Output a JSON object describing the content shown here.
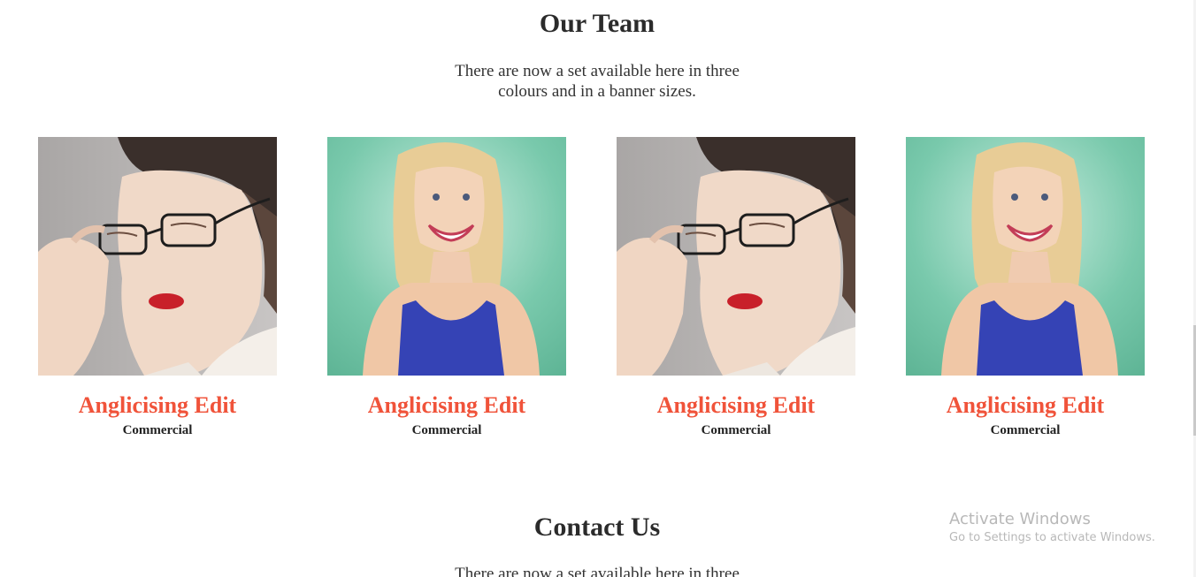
{
  "team": {
    "title": "Our Team",
    "description_lines": [
      "There are now a set available here in three",
      "colours and in a banner sizes."
    ],
    "members": [
      {
        "name": "Anglicising Edit",
        "role": "Commercial",
        "photo": "brunette-glasses-portrait"
      },
      {
        "name": "Anglicising Edit",
        "role": "Commercial",
        "photo": "blonde-smiling-portrait"
      },
      {
        "name": "Anglicising Edit",
        "role": "Commercial",
        "photo": "brunette-glasses-portrait"
      },
      {
        "name": "Anglicising Edit",
        "role": "Commercial",
        "photo": "blonde-smiling-portrait"
      }
    ]
  },
  "contact": {
    "title": "Contact Us",
    "description_line": "There are now a set available here in three"
  },
  "watermark": {
    "line1": "Activate Windows",
    "line2": "Go to Settings to activate Windows."
  },
  "colors": {
    "accent": "#f0533a",
    "heading": "#2b2b2b",
    "teal_bg": "#6fc3a6",
    "gray_bg": "#b9b6b5"
  }
}
